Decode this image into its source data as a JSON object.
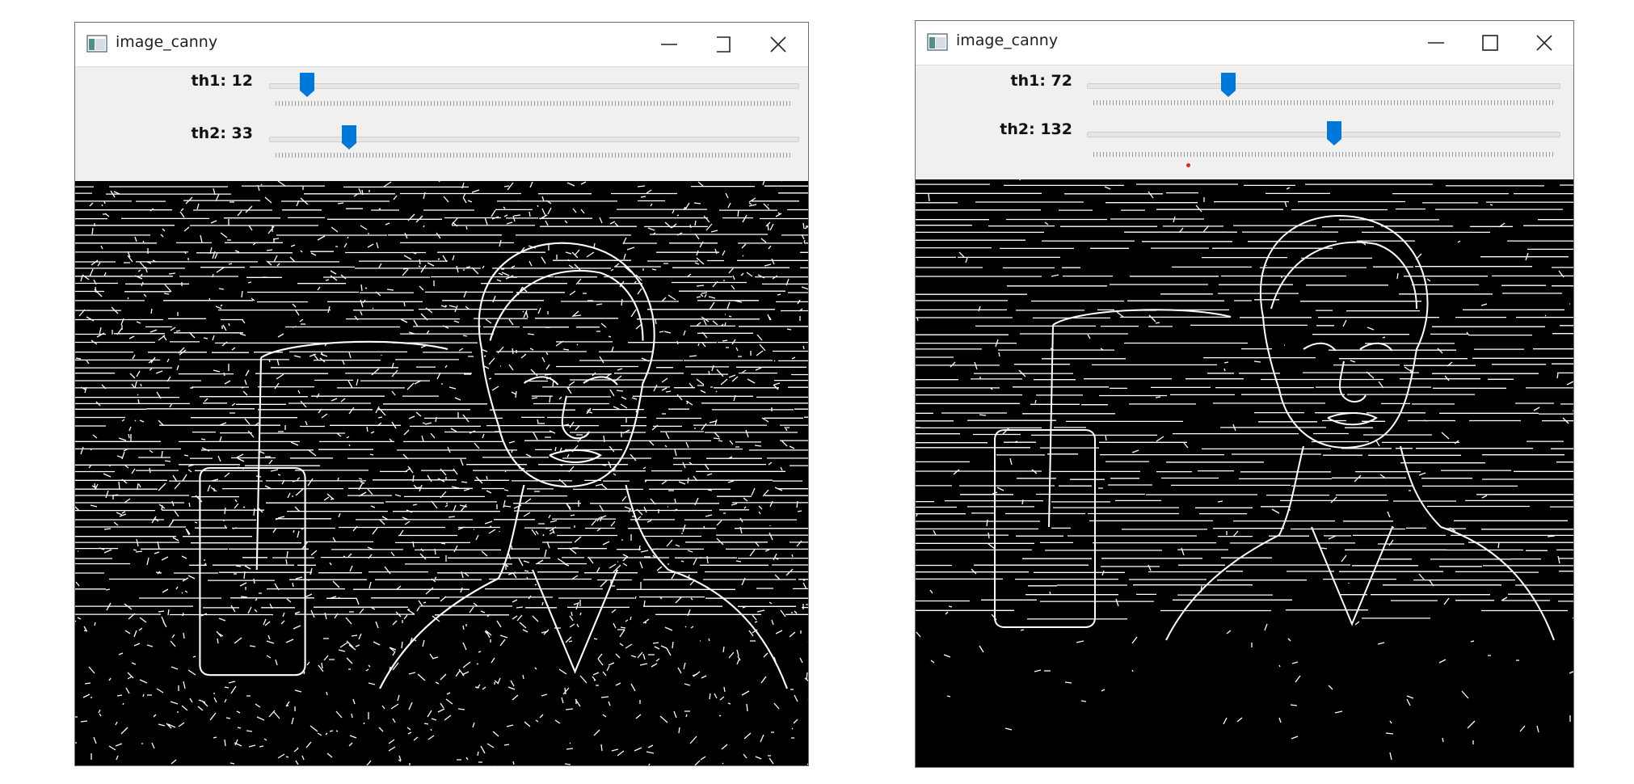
{
  "windows": [
    {
      "title": "image_canny",
      "icon": "app-window-icon",
      "trackbars": [
        {
          "label": "th1: 12",
          "name": "th1",
          "value": 12,
          "max": 255
        },
        {
          "label": "th2: 33",
          "name": "th2",
          "value": 33,
          "max": 255
        }
      ]
    },
    {
      "title": "image_canny",
      "icon": "app-window-icon",
      "trackbars": [
        {
          "label": "th1: 72",
          "name": "th1",
          "value": 72,
          "max": 255
        },
        {
          "label": "th2: 132",
          "name": "th2",
          "value": 132,
          "max": 255
        }
      ]
    }
  ],
  "colors": {
    "thumb": "#0078d7",
    "edge": "#ffffff",
    "image_background": "#000000",
    "marker": "#e3262b"
  }
}
